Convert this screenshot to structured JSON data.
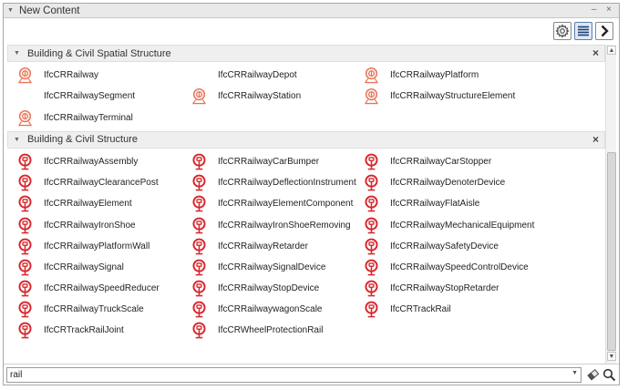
{
  "window": {
    "title": "New Content",
    "minimize_glyph": "–",
    "close_glyph": "×"
  },
  "toolbar": {
    "buttons": [
      {
        "icon": "gear-icon"
      },
      {
        "icon": "list-view-icon",
        "active": true
      },
      {
        "icon": "chevron-right-icon"
      }
    ]
  },
  "sections": [
    {
      "title": "Building & Civil Spatial Structure",
      "items": [
        {
          "label": "IfcCRRailway",
          "icon": "spatial"
        },
        {
          "label": "IfcCRRailwayDepot",
          "icon": "none"
        },
        {
          "label": "IfcCRRailwayPlatform",
          "icon": "spatial"
        },
        {
          "label": "IfcCRRailwaySegment",
          "icon": "none"
        },
        {
          "label": "IfcCRRailwayStation",
          "icon": "spatial"
        },
        {
          "label": "IfcCRRailwayStructureElement",
          "icon": "spatial"
        },
        {
          "label": "IfcCRRailwayTerminal",
          "icon": "spatial"
        }
      ]
    },
    {
      "title": "Building & Civil Structure",
      "items": [
        {
          "label": "IfcCRRailwayAssembly",
          "icon": "element"
        },
        {
          "label": "IfcCRRailwayCarBumper",
          "icon": "element"
        },
        {
          "label": "IfcCRRailwayCarStopper",
          "icon": "element"
        },
        {
          "label": "IfcCRRailwayClearancePost",
          "icon": "element"
        },
        {
          "label": "IfcCRRailwayDeflectionInstrument",
          "icon": "element"
        },
        {
          "label": "IfcCRRailwayDenoterDevice",
          "icon": "element"
        },
        {
          "label": "IfcCRRailwayElement",
          "icon": "element"
        },
        {
          "label": "IfcCRRailwayElementComponent",
          "icon": "element"
        },
        {
          "label": "IfcCRRailwayFlatAisle",
          "icon": "element"
        },
        {
          "label": "IfcCRRailwayIronShoe",
          "icon": "element"
        },
        {
          "label": "IfcCRRailwayIronShoeRemoving",
          "icon": "element"
        },
        {
          "label": "IfcCRRailwayMechanicalEquipment",
          "icon": "element"
        },
        {
          "label": "IfcCRRailwayPlatformWall",
          "icon": "element"
        },
        {
          "label": "IfcCRRailwayRetarder",
          "icon": "element"
        },
        {
          "label": "IfcCRRailwaySafetyDevice",
          "icon": "element"
        },
        {
          "label": "IfcCRRailwaySignal",
          "icon": "element"
        },
        {
          "label": "IfcCRRailwaySignalDevice",
          "icon": "element"
        },
        {
          "label": "IfcCRRailwaySpeedControlDevice",
          "icon": "element"
        },
        {
          "label": "IfcCRRailwaySpeedReducer",
          "icon": "element"
        },
        {
          "label": "IfcCRRailwayStopDevice",
          "icon": "element"
        },
        {
          "label": "IfcCRRailwayStopRetarder",
          "icon": "element"
        },
        {
          "label": "IfcCRRailwayTruckScale",
          "icon": "element"
        },
        {
          "label": "IfcCRRailwaywagonScale",
          "icon": "element"
        },
        {
          "label": "IfcCRTrackRail",
          "icon": "element"
        },
        {
          "label": "IfcCRTrackRailJoint",
          "icon": "element"
        },
        {
          "label": "IfcCRWheelProtectionRail",
          "icon": "element"
        }
      ]
    }
  ],
  "search": {
    "value": "rail"
  },
  "colors": {
    "spatial_icon": "#e8735a",
    "element_icon": "#d7262b",
    "accent": "#5b7fb0"
  }
}
